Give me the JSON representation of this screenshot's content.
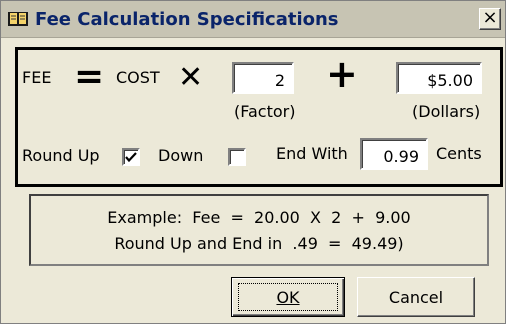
{
  "window": {
    "title": "Fee Calculation Specifications",
    "close_label": "×"
  },
  "formula": {
    "fee_label": "FEE",
    "equals_symbol": "=",
    "cost_label": "COST",
    "times_symbol": "✕",
    "factor_value": "2",
    "factor_caption": "(Factor)",
    "plus_symbol": "+",
    "dollars_value": "$5.00",
    "dollars_caption": "(Dollars)"
  },
  "rounding": {
    "round_up_label": "Round Up",
    "round_up_checked": true,
    "down_label": "Down",
    "down_checked": false,
    "end_with_label": "End With",
    "end_with_value": "0.99",
    "cents_label": "Cents"
  },
  "example": {
    "line1": "Example:  Fee  =  20.00  X  2  +  9.00",
    "line2": "Round Up and End in  .49  =  49.49)"
  },
  "buttons": {
    "ok_label": "OK",
    "cancel_label": "Cancel"
  }
}
